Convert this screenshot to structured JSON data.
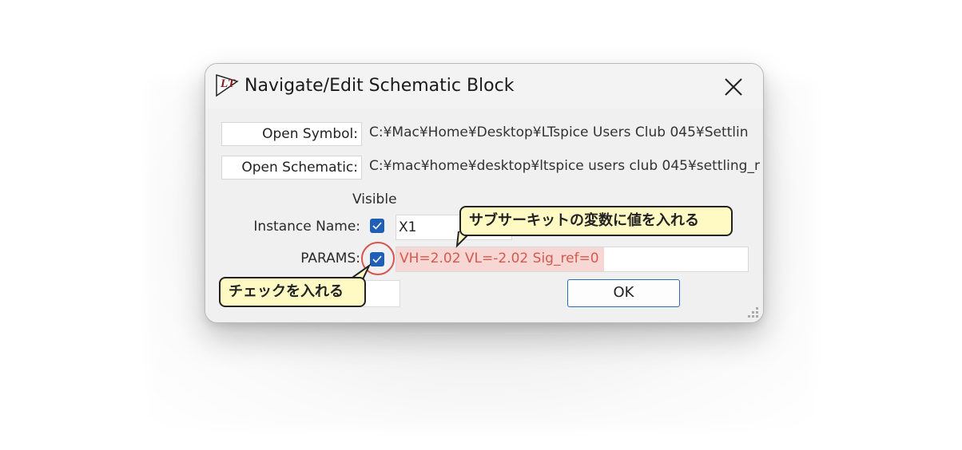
{
  "dialog": {
    "title": "Navigate/Edit Schematic Block",
    "icon": "ltspice-logo-icon",
    "close_icon": "close-icon"
  },
  "rows": {
    "open_symbol": {
      "label": "Open Symbol:",
      "path": "C:¥Mac¥Home¥Desktop¥LTspice Users Club 045¥Settlin"
    },
    "open_schematic": {
      "label": "Open Schematic:",
      "path": "C:¥mac¥home¥desktop¥ltspice users club 045¥settling_r"
    },
    "visible_header": "Visible",
    "instance_name": {
      "label": "Instance Name:",
      "checked": true,
      "value": "X1"
    },
    "params": {
      "label": "PARAMS:",
      "checked": true,
      "value": "VH=2.02  VL=-2.02  Sig_ref=0"
    }
  },
  "buttons": {
    "ok": "OK"
  },
  "annotations": {
    "subcircuit_callout": "サブサーキットの変数に値を入れる",
    "check_callout": "チェックを入れる"
  },
  "colors": {
    "checkbox": "#1f5fb6",
    "ok_border": "#2b6cb8",
    "highlight": "#f7d7d3",
    "callout_fill": "#fff9c4",
    "circle": "#d9534f"
  }
}
